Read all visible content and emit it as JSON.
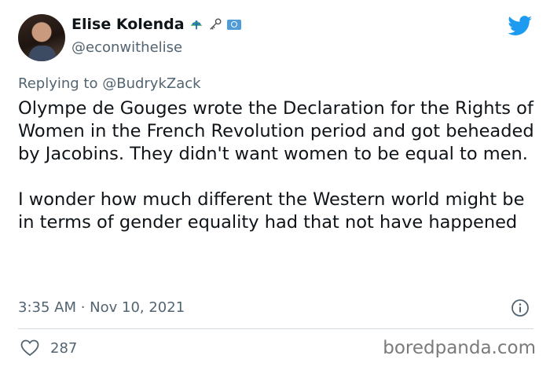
{
  "author": {
    "display_name": "Elise Kolenda",
    "handle": "@econwithelise",
    "badges": [
      "peacock-emoji",
      "old-key-emoji",
      "united-nations-flag-emoji"
    ]
  },
  "reply": {
    "prefix": "Replying to",
    "mention": "@BudrykZack"
  },
  "tweet": {
    "paragraph_1": "Olympe de Gouges wrote the Declaration for the Rights of Women in the French Revolution period and got beheaded by Jacobins. They didn't want women to be equal to men.",
    "paragraph_2": "I wonder how much different the Western world might be in terms of gender equality had that not have happened"
  },
  "meta": {
    "timestamp": "3:35 AM · Nov 10, 2021",
    "likes": "287"
  },
  "watermark": "boredpanda.com",
  "colors": {
    "twitter_blue": "#1d9bf0",
    "secondary_text": "#536471"
  }
}
